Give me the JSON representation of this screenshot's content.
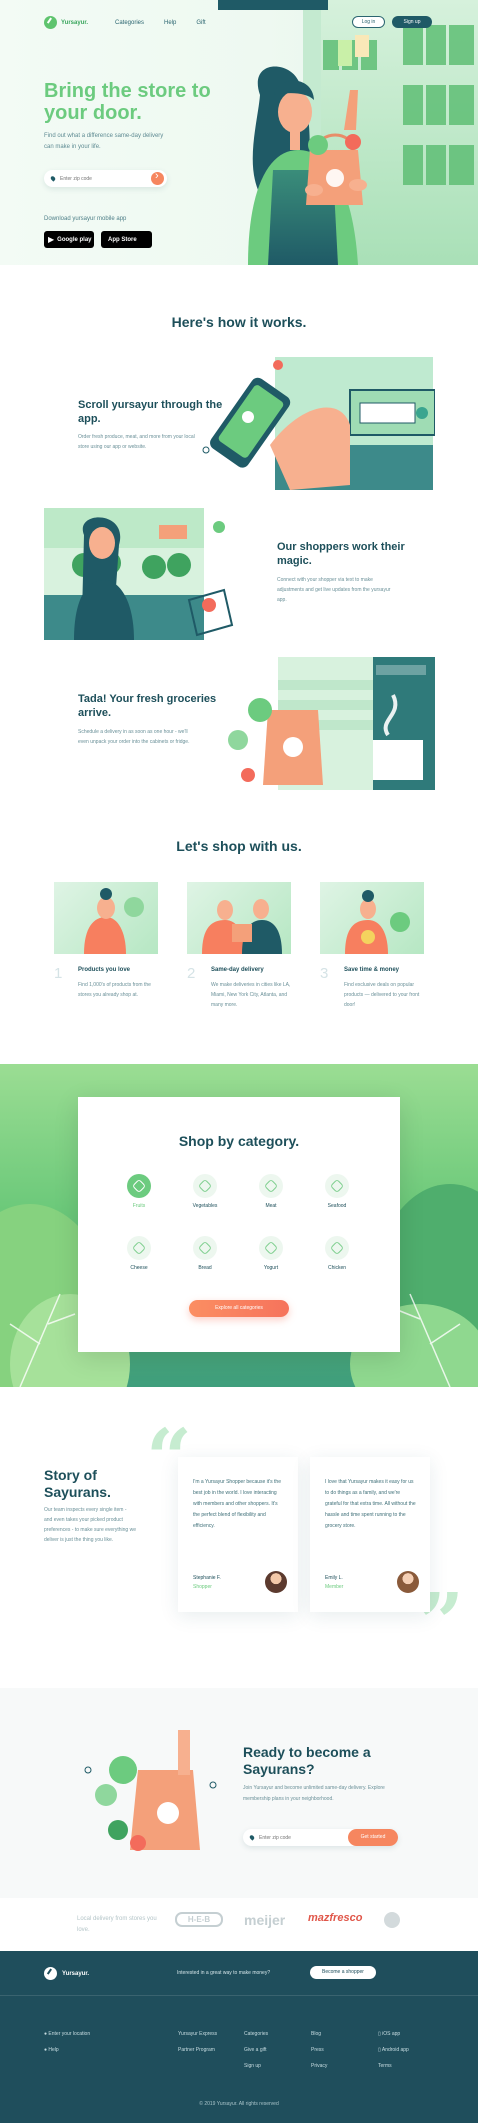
{
  "header": {
    "logo_text": "Yursayur.",
    "nav": [
      "Categories",
      "Help",
      "Gift"
    ],
    "login_label": "Log in",
    "signup_label": "Sign up"
  },
  "hero": {
    "title": "Bring the store to your door.",
    "subtitle": "Find out what a difference same-day delivery can make in your life.",
    "zip_placeholder": "Enter zip code",
    "download_label": "Download yursayur mobile app",
    "google_play": "Google play",
    "app_store": "App Store"
  },
  "how": {
    "title": "Here's how it works.",
    "steps": [
      {
        "title": "Scroll yursayur through the app.",
        "text": "Order fresh produce, meat, and more from your local store using our app or website."
      },
      {
        "title": "Our shoppers work their magic.",
        "text": "Connect with your shopper via text to make adjustments and get live updates from the yursayur app."
      },
      {
        "title": "Tada! Your fresh groceries arrive.",
        "text": "Schedule a delivery in as soon as one hour - we'll even unpack your order into the cabinets or fridge."
      }
    ]
  },
  "shop": {
    "title": "Let's shop with us.",
    "cards": [
      {
        "num": "1",
        "title": "Products you love",
        "text": "Find 1,000's of products from the stores you already shop at."
      },
      {
        "num": "2",
        "title": "Same-day delivery",
        "text": "We make deliveries in cities like LA, Miami, New York City, Atlanta, and many more."
      },
      {
        "num": "3",
        "title": "Save time & money",
        "text": "Find exclusive deals on popular products — delivered to your front door!"
      }
    ]
  },
  "category": {
    "title": "Shop by category.",
    "items": [
      "Fruits",
      "Vegetables",
      "Meat",
      "Seafood",
      "Cheese",
      "Bread",
      "Yogurt",
      "Chicken"
    ],
    "active": "Fruits",
    "button": "Explore all categories"
  },
  "story": {
    "title": "Story of Sayurans.",
    "text": "Our team inspects every single item - and even takes your picked product preferences - to make sure everything we deliver is just the thing you like.",
    "testimonials": [
      {
        "text": "I'm a Yursayur Shopper because it's the best job in the world. I love interacting with members and other shoppers. It's the perfect blend of flexibility and efficiency.",
        "name": "Stephanie F.",
        "role": "Shopper"
      },
      {
        "text": "I love that Yursayur makes it easy for us to do things as a family, and we're grateful for that extra time. All without the hassle and time spent running to the grocery store.",
        "name": "Emily L.",
        "role": "Member"
      }
    ]
  },
  "ready": {
    "title": "Ready to become a Sayurans?",
    "text": "Join Yursayur and become unlimited same-day delivery. Explore membership plans in your neighborhood.",
    "zip_placeholder": "Enter zip code",
    "button": "Get started"
  },
  "partners": {
    "label": "Local delivery from stores you love.",
    "names": [
      "H-E-B",
      "meijer",
      "mazfresco"
    ]
  },
  "footer": {
    "logo_text": "Yursayur.",
    "cta_text": "Interested in a great way to make money?",
    "cta_button": "Become a shopper",
    "col1": [
      "Enter your location",
      "Help"
    ],
    "col2": [
      "Yursayur Express",
      "Partner Program"
    ],
    "col3": [
      "Categories",
      "Give a gift",
      "Sign up"
    ],
    "col4": [
      "Blog",
      "Press",
      "Privacy"
    ],
    "col5": [
      "iOS app",
      "Android app",
      "Terms"
    ],
    "copyright": "© 2019 Yursayur. All rights reserved"
  },
  "colors": {
    "accent_green": "#6ccb7f",
    "dark_teal": "#1d4f5a",
    "orange": "#f6865f",
    "footer_bg": "#1f4e5c"
  }
}
